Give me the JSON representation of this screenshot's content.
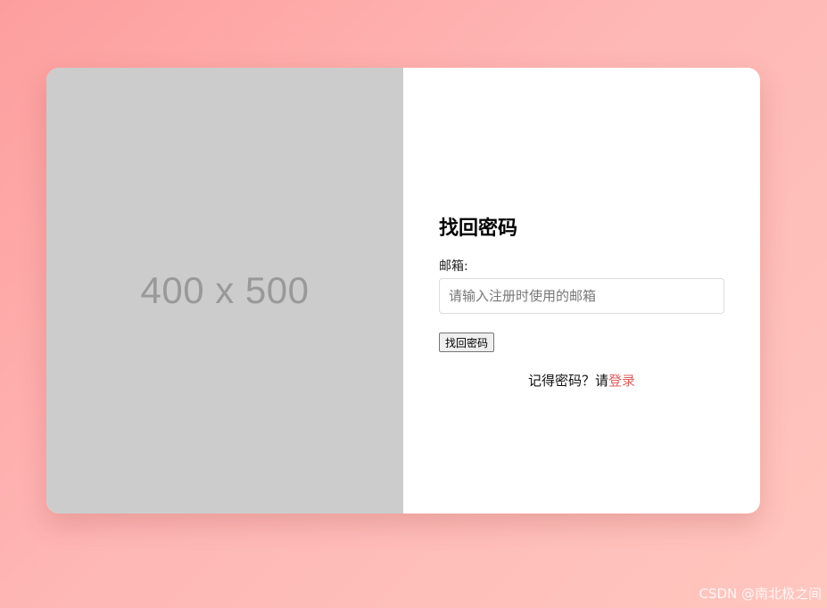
{
  "image_placeholder": {
    "text": "400 x 500"
  },
  "form": {
    "title": "找回密码",
    "email_label": "邮箱:",
    "email_placeholder": "请输入注册时使用的邮箱",
    "email_value": "",
    "submit_label": "找回密码"
  },
  "footer": {
    "prompt": "记得密码？请",
    "login_link": "登录"
  },
  "watermark": "CSDN @南北极之间",
  "colors": {
    "link": "#e35c5c",
    "placeholder_bg": "#cccccc",
    "background_gradient_start": "#fd9e9e",
    "background_gradient_end": "#ffc6be"
  }
}
